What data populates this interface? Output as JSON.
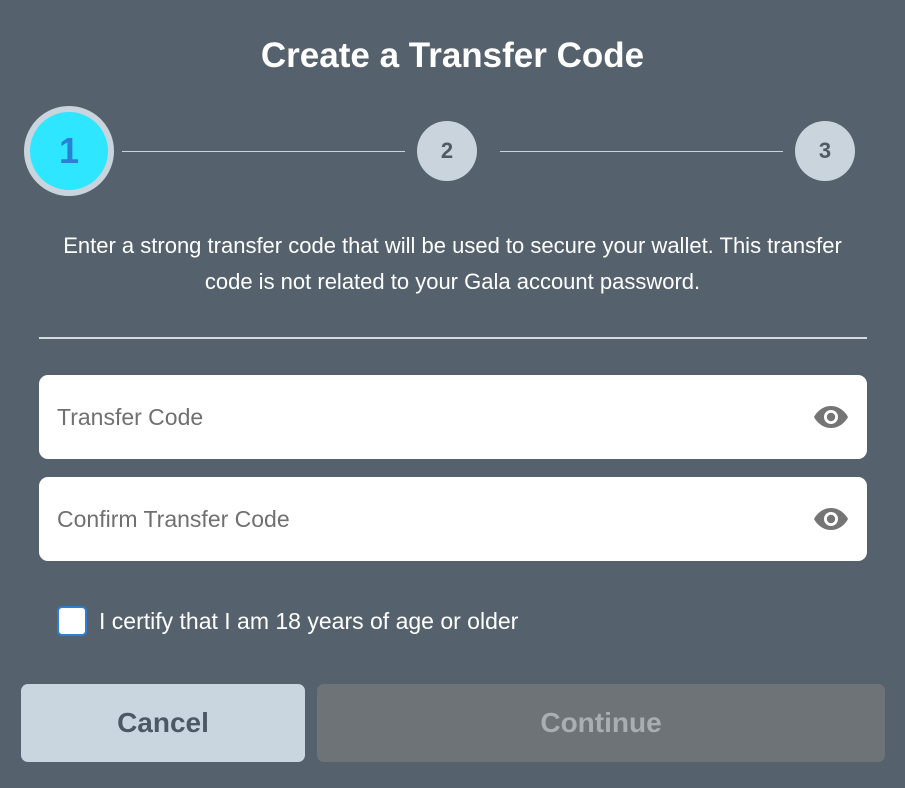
{
  "dialog": {
    "title": "Create a Transfer Code"
  },
  "stepper": {
    "steps": [
      {
        "label": "1",
        "state": "active"
      },
      {
        "label": "2",
        "state": "inactive"
      },
      {
        "label": "3",
        "state": "inactive"
      }
    ],
    "current_step": 1
  },
  "instructions": "Enter a strong transfer code that will be used to secure your wallet. This transfer code is not related to your Gala account password.",
  "fields": {
    "transfer_code": {
      "placeholder": "Transfer Code",
      "value": "",
      "icon": "eye-icon"
    },
    "confirm_transfer_code": {
      "placeholder": "Confirm Transfer Code",
      "value": "",
      "icon": "eye-icon"
    }
  },
  "certify": {
    "label": "I certify that I am 18 years of age or older",
    "checked": false
  },
  "buttons": {
    "cancel": "Cancel",
    "continue": "Continue",
    "continue_disabled": true
  },
  "colors": {
    "background": "#55626d",
    "active_step": "#2ee6ff",
    "active_step_text": "#2b7fd6",
    "inactive_step": "#c9d4dc",
    "cancel_bg": "#c9d6e0",
    "continue_disabled_bg": "#6e7378"
  }
}
